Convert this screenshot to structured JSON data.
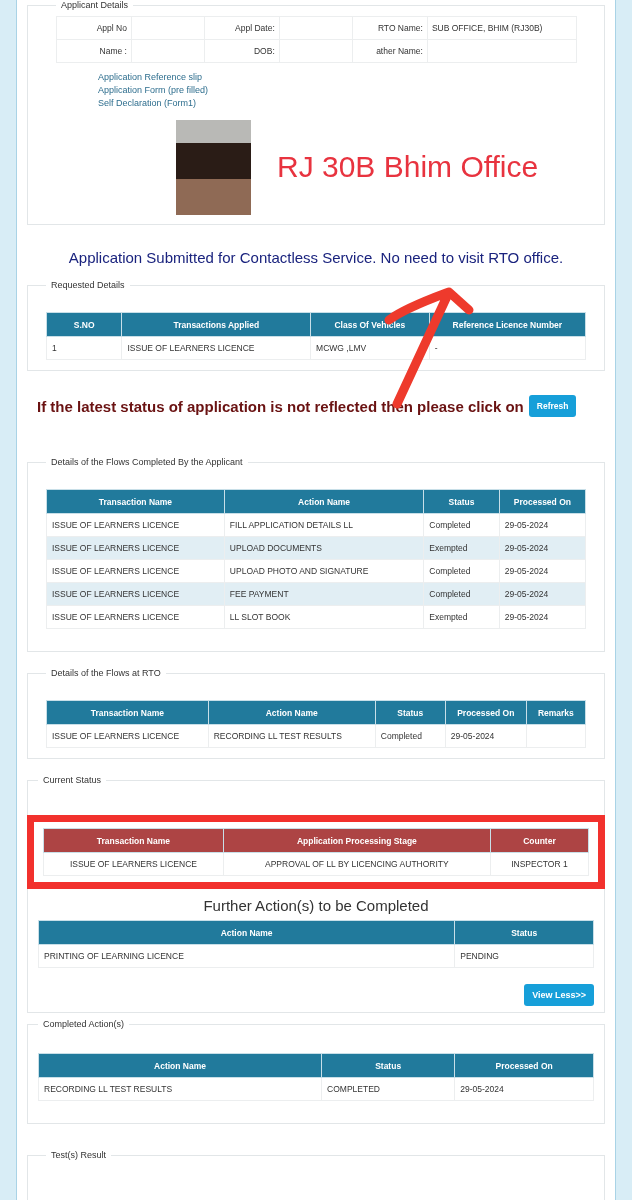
{
  "applicant_details": {
    "legend": "Applicant Details",
    "fields": [
      [
        {
          "label": "Appl No"
        },
        {
          "label": "Appl Date:"
        },
        {
          "label": "RTO Name:",
          "value": "SUB OFFICE, BHIM (RJ30B)"
        }
      ],
      [
        {
          "label": "Name :"
        },
        {
          "label": "DOB:"
        },
        {
          "label": "ather  Name:"
        }
      ]
    ],
    "links": [
      "Application Reference slip",
      "Application Form (pre filled)",
      "Self Declaration (Form1)"
    ],
    "annotation": "RJ 30B Bhim Office"
  },
  "notice": "Application Submitted for Contactless Service. No need to visit RTO office.",
  "requested_details": {
    "legend": "Requested Details",
    "columns": [
      "S.NO",
      "Transactions Applied",
      "Class Of Vehicles",
      "Reference Licence Number"
    ],
    "rows": [
      [
        "1",
        "ISSUE OF LEARNERS LICENCE",
        "MCWG ,LMV",
        "-"
      ]
    ]
  },
  "refresh_prompt": {
    "text": "If the latest status of application is not reflected then please click on",
    "button": "Refresh"
  },
  "applicant_flows": {
    "legend": "Details of the Flows Completed By the Applicant",
    "columns": [
      "Transaction Name",
      "Action Name",
      "Status",
      "Processed On"
    ],
    "rows": [
      [
        "ISSUE OF LEARNERS LICENCE",
        "FILL APPLICATION DETAILS LL",
        "Completed",
        "29-05-2024"
      ],
      [
        "ISSUE OF LEARNERS LICENCE",
        "UPLOAD DOCUMENTS",
        "Exempted",
        "29-05-2024"
      ],
      [
        "ISSUE OF LEARNERS LICENCE",
        "UPLOAD PHOTO AND SIGNATURE",
        "Completed",
        "29-05-2024"
      ],
      [
        "ISSUE OF LEARNERS LICENCE",
        "FEE PAYMENT",
        "Completed",
        "29-05-2024"
      ],
      [
        "ISSUE OF LEARNERS LICENCE",
        "LL SLOT BOOK",
        "Exempted",
        "29-05-2024"
      ]
    ]
  },
  "rto_flows": {
    "legend": "Details of the Flows at RTO",
    "columns": [
      "Transaction Name",
      "Action Name",
      "Status",
      "Processed On",
      "Remarks"
    ],
    "rows": [
      [
        "ISSUE OF LEARNERS LICENCE",
        "RECORDING LL TEST RESULTS",
        "Completed",
        "29-05-2024",
        ""
      ]
    ]
  },
  "current_status": {
    "legend": "Current Status",
    "columns": [
      "Transaction Name",
      "Application Processing Stage",
      "Counter"
    ],
    "rows": [
      [
        "ISSUE OF LEARNERS LICENCE",
        "APPROVAL OF LL BY LICENCING AUTHORITY",
        "INSPECTOR 1"
      ]
    ]
  },
  "further_actions": {
    "title": "Further Action(s) to be Completed",
    "columns": [
      "Action Name",
      "Status"
    ],
    "rows": [
      [
        "PRINTING OF LEARNING LICENCE",
        "PENDING"
      ]
    ],
    "button": "View Less>>"
  },
  "completed_actions": {
    "legend": "Completed Action(s)",
    "columns": [
      "Action Name",
      "Status",
      "Processed On"
    ],
    "rows": [
      [
        "RECORDING LL TEST RESULTS",
        "COMPLETED",
        "29-05-2024"
      ]
    ]
  },
  "test_results": {
    "legend": "Test(s) Result"
  }
}
